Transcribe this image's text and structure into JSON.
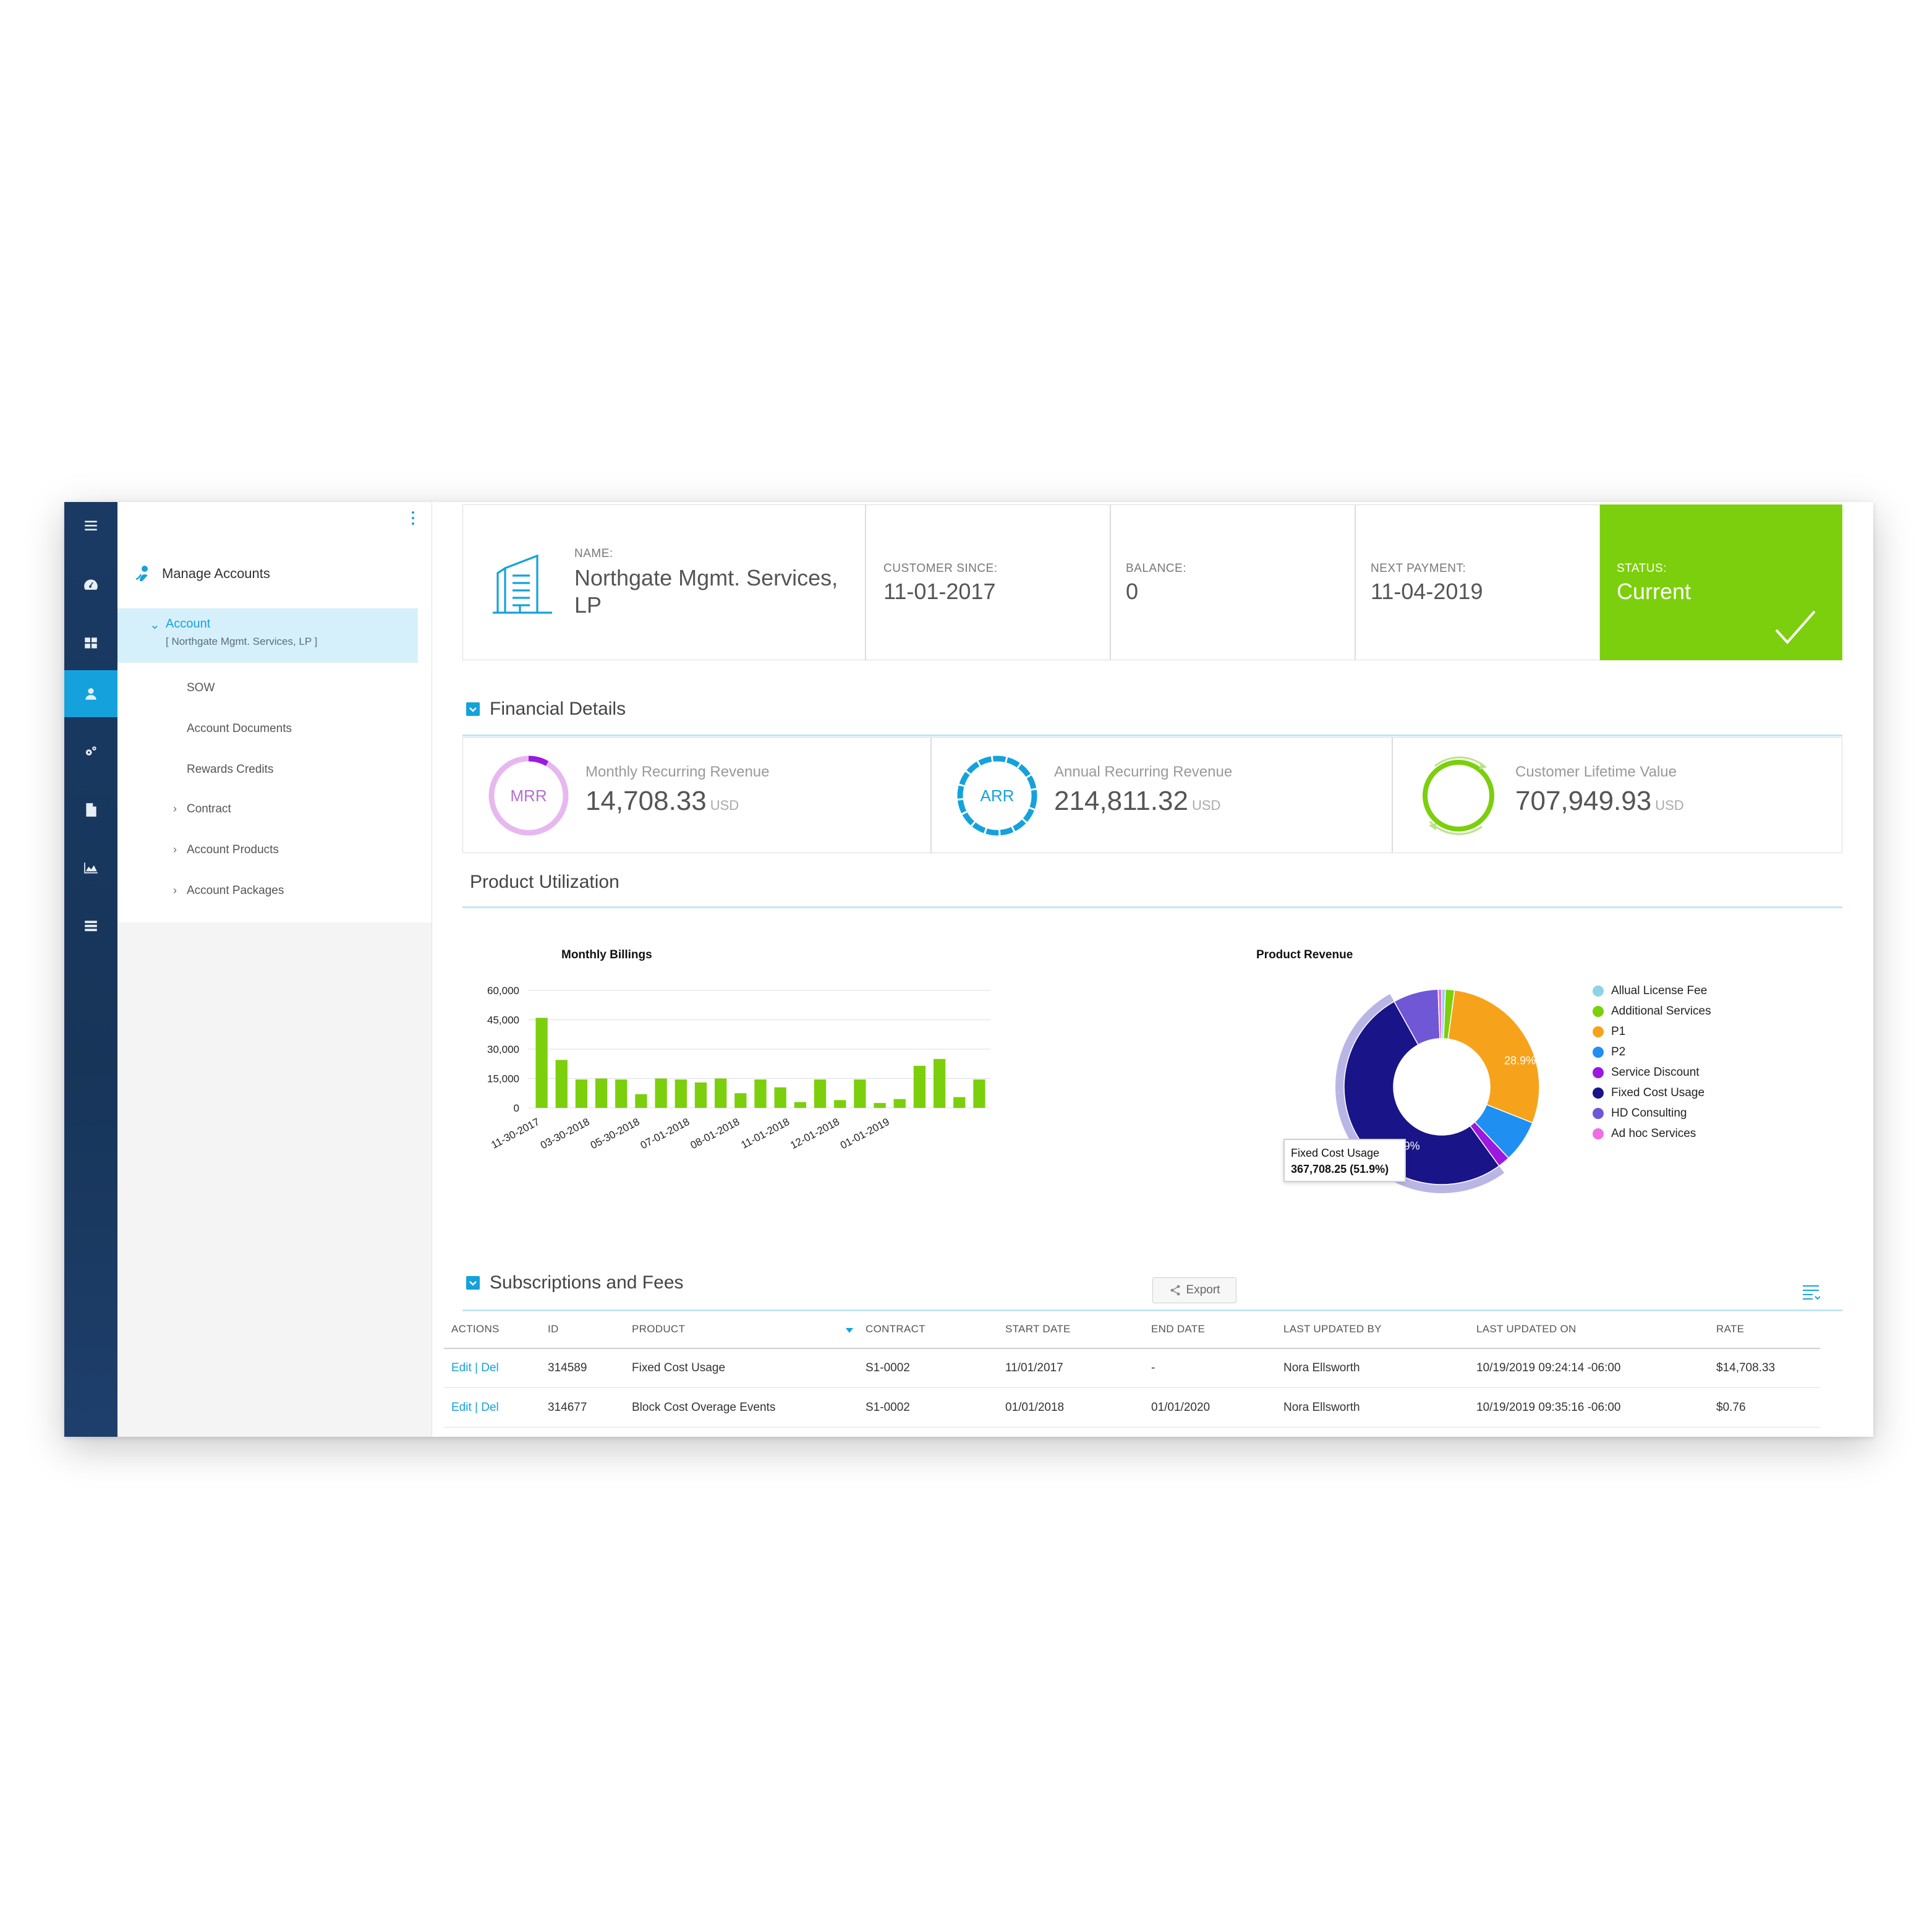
{
  "nav": {
    "title": "Manage Accounts",
    "account_label": "Account",
    "account_sub": "[ Northgate Mgmt. Services, LP ]",
    "links": [
      "SOW",
      "Account Documents",
      "Rewards Credits"
    ],
    "expandable": [
      "Contract",
      "Account Products",
      "Account Packages"
    ]
  },
  "summary": {
    "name_label": "NAME:",
    "name_line1": "Northgate Mgmt. Services,",
    "name_line2": "LP",
    "since_label": "CUSTOMER SINCE:",
    "since_value": "11-01-2017",
    "balance_label": "BALANCE:",
    "balance_value": "0",
    "next_label": "NEXT PAYMENT:",
    "next_value": "11-04-2019",
    "status_label": "STATUS:",
    "status_value": "Current"
  },
  "financial": {
    "title": "Financial Details",
    "mrr": {
      "badge": "MRR",
      "label": "Monthly Recurring Revenue",
      "value": "14,708.33",
      "unit": "USD"
    },
    "arr": {
      "badge": "ARR",
      "label": "Annual Recurring Revenue",
      "value": "214,811.32",
      "unit": "USD"
    },
    "clv": {
      "label": "Customer Lifetime Value",
      "value": "707,949.93",
      "unit": "USD"
    }
  },
  "utilization": {
    "title": "Product Utilization"
  },
  "chart_data": [
    {
      "type": "bar",
      "title": "Monthly Billings",
      "ylim": [
        0,
        60000
      ],
      "yticks": [
        "60,000",
        "45,000",
        "30,000",
        "15,000",
        "0"
      ],
      "xticks": [
        "11-30-2017",
        "03-30-2018",
        "05-30-2018",
        "07-01-2018",
        "08-01-2018",
        "11-01-2018",
        "12-01-2018",
        "01-01-2019"
      ],
      "values": [
        46000,
        24500,
        14500,
        15000,
        14500,
        7000,
        15000,
        14500,
        13000,
        15000,
        7500,
        14500,
        10500,
        3000,
        14500,
        4000,
        14500,
        2500,
        4500,
        21500,
        25000,
        5500,
        14500
      ],
      "color": "#7ccf0c"
    },
    {
      "type": "pie",
      "title": "Product Revenue",
      "labels": [
        "Allual License Fee",
        "Additional Services",
        "P1",
        "P2",
        "Service Discount",
        "Fixed Cost Usage",
        "HD Consulting",
        "Ad hoc Services"
      ],
      "values": [
        0.6,
        1.5,
        28.9,
        7.0,
        2.0,
        51.9,
        7.5,
        0.6
      ],
      "colors": [
        "#8fd3e8",
        "#7ccf0c",
        "#f7a21b",
        "#1f8ff2",
        "#9b19e0",
        "#1a1489",
        "#6f57d6",
        "#ef6ee6"
      ],
      "data_labels": [
        "28.9%",
        "51.9%"
      ],
      "tooltip": {
        "title": "Fixed Cost Usage",
        "value": "367,708.25 (51.9%)"
      },
      "legend": "right"
    }
  ],
  "subscriptions": {
    "title": "Subscriptions and Fees",
    "export_label": "Export",
    "headers": [
      "ACTIONS",
      "ID",
      "PRODUCT",
      "CONTRACT",
      "START DATE",
      "END DATE",
      "LAST UPDATED BY",
      "LAST UPDATED ON",
      "RATE"
    ],
    "rows": [
      {
        "edit": "Edit",
        "sep": "|",
        "del": "Del",
        "id": "314589",
        "product": "Fixed Cost Usage",
        "contract": "S1-0002",
        "start": "11/01/2017",
        "end": "-",
        "by": "Nora Ellsworth",
        "on": "10/19/2019 09:24:14 -06:00",
        "rate": "$14,708.33"
      },
      {
        "edit": "Edit",
        "sep": "|",
        "del": "Del",
        "id": "314677",
        "product": "Block Cost Overage Events",
        "contract": "S1-0002",
        "start": "01/01/2018",
        "end": "01/01/2020",
        "by": "Nora Ellsworth",
        "on": "10/19/2019 09:35:16 -06:00",
        "rate": "$0.76"
      }
    ]
  },
  "colors": {
    "accent": "#15a2dc",
    "status": "#7ccf0c",
    "rail": "#1a3a64"
  }
}
